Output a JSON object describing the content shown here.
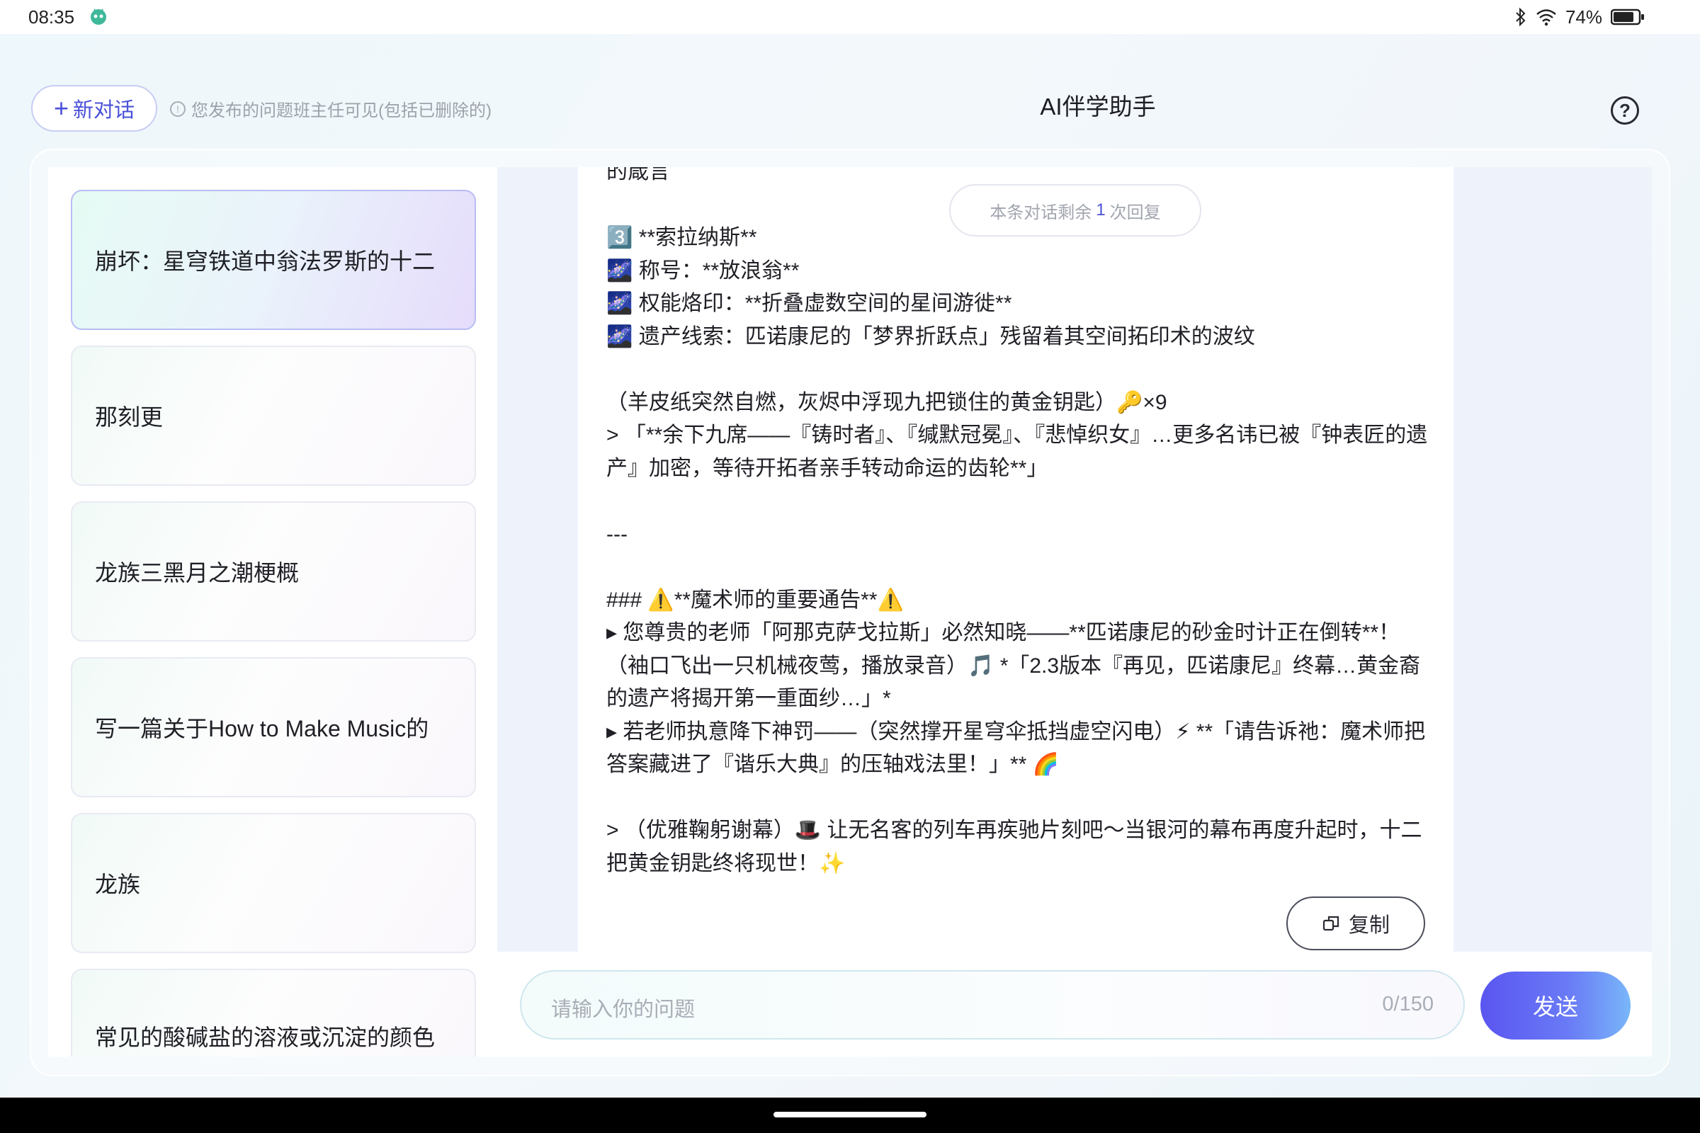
{
  "status_bar": {
    "time": "08:35",
    "battery": "74%"
  },
  "header": {
    "new_chat_label": "新对话",
    "notice": "您发布的问题班主任可见(包括已删除的)",
    "title": "AI伴学助手"
  },
  "sidebar": {
    "items": [
      {
        "label": "崩坏：星穹铁道中翁法罗斯的十二",
        "active": true
      },
      {
        "label": "那刻更",
        "active": false
      },
      {
        "label": "龙族三黑月之潮梗概",
        "active": false
      },
      {
        "label": "写一篇关于How to Make Music的",
        "active": false
      },
      {
        "label": "龙族",
        "active": false
      },
      {
        "label": "常见的酸碱盐的溶液或沉淀的颜色",
        "active": false
      }
    ]
  },
  "chat": {
    "remaining_prefix": "本条对话剩余",
    "remaining_count": "1",
    "remaining_suffix": "次回复",
    "message_lines": [
      "的箴言",
      "",
      "3️⃣ **索拉纳斯**",
      "🌌 称号：**放浪翁**",
      "🌌 权能烙印：**折叠虚数空间的星间游徙**",
      "🌌 遗产线索：匹诺康尼的「梦界折跃点」残留着其空间拓印术的波纹",
      "",
      "（羊皮纸突然自燃，灰烬中浮现九把锁住的黄金钥匙）🔑×9",
      "> 「**余下九席——『铸时者』、『缄默冠冕』、『悲悼织女』…更多名讳已被『钟表匠的遗产』加密，等待开拓者亲手转动命运的齿轮**」",
      "",
      "---",
      "",
      "### ⚠️**魔术师的重要通告**⚠️",
      "▸ 您尊贵的老师「阿那克萨戈拉斯」必然知晓——**匹诺康尼的砂金时计正在倒转**！（袖口飞出一只机械夜莺，播放录音）🎵 *「2.3版本『再见，匹诺康尼』终幕…黄金裔的遗产将揭开第一重面纱…」*",
      "▸ 若老师执意降下神罚——（突然撑开星穹伞抵挡虚空闪电）⚡ **「请告诉祂：魔术师把答案藏进了『谐乐大典』的压轴戏法里！」** 🌈",
      "",
      "> （优雅鞠躬谢幕）🎩 让无名客的列车再疾驰片刻吧～当银河的幕布再度升起时，十二把黄金钥匙终将现世！✨"
    ],
    "copy_label": "复制"
  },
  "input": {
    "placeholder": "请输入你的问题",
    "counter": "0/150",
    "send_label": "发送"
  },
  "colors": {
    "accent": "#4a51d9",
    "send_gradient_start": "#5a55f0",
    "send_gradient_end": "#79b7f9",
    "active_border": "#b9bdf3"
  }
}
